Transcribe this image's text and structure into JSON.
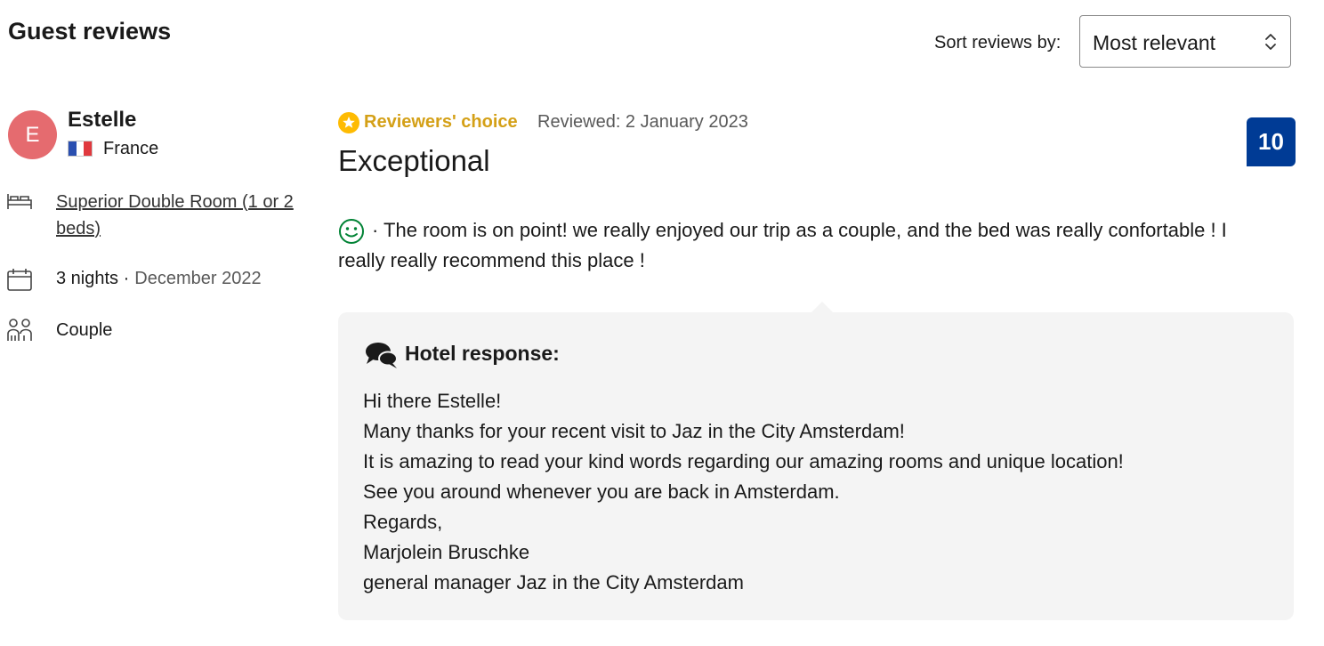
{
  "header": {
    "title": "Guest reviews",
    "sort_label": "Sort reviews by:",
    "sort_selected": "Most relevant"
  },
  "reviewer": {
    "initial": "E",
    "name": "Estelle",
    "country": "France",
    "avatar_color": "#e56b6f"
  },
  "stay": {
    "room": "Superior Double Room (1 or 2 beds)",
    "nights": "3 nights ·",
    "date": "December 2022",
    "traveler_type": "Couple"
  },
  "review": {
    "badge": "Reviewers' choice",
    "reviewed_date": "Reviewed: 2 January 2023",
    "title": "Exceptional",
    "score": "10",
    "text": "· The room is on point! we really enjoyed our trip as a couple, and the bed was really confortable ! I really really recommend this place !",
    "score_color": "#003b95",
    "badge_color": "#febb02"
  },
  "hotel_response": {
    "title": "Hotel response:",
    "lines": [
      "Hi there Estelle!",
      "Many thanks for your recent visit to Jaz in the City Amsterdam!",
      "It is amazing to read your kind words regarding our amazing rooms and unique location!",
      "See you around whenever you are back in Amsterdam.",
      "Regards,",
      "Marjolein Bruschke",
      "general manager Jaz in the City Amsterdam"
    ]
  },
  "icons": {
    "sort": "chevron-up-down-icon",
    "room": "bed-icon",
    "stay": "calendar-icon",
    "traveler": "people-icon",
    "badge": "star-icon",
    "sentiment": "smile-icon",
    "response": "chat-bubbles-icon"
  }
}
